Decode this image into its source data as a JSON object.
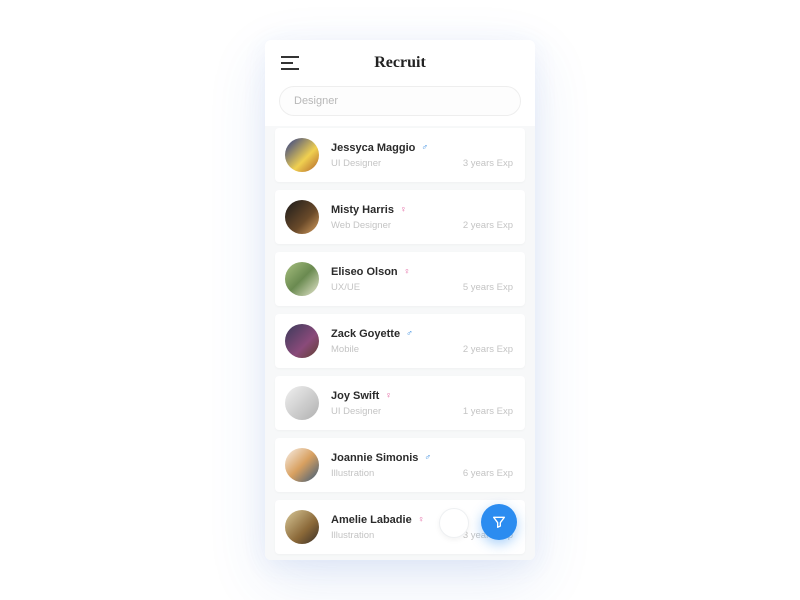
{
  "header": {
    "title": "Recruit"
  },
  "search": {
    "value": "Designer"
  },
  "candidates": [
    {
      "name": "Jessyca Maggio",
      "gender": "m",
      "role": "UI Designer",
      "exp": "3 years Exp"
    },
    {
      "name": "Misty Harris",
      "gender": "f",
      "role": "Web Designer",
      "exp": "2 years Exp"
    },
    {
      "name": "Eliseo Olson",
      "gender": "f",
      "role": "UX/UE",
      "exp": "5 years Exp"
    },
    {
      "name": "Zack Goyette",
      "gender": "m",
      "role": "Mobile",
      "exp": "2 years Exp"
    },
    {
      "name": "Joy Swift",
      "gender": "f",
      "role": "UI Designer",
      "exp": "1 years Exp"
    },
    {
      "name": "Joannie Simonis",
      "gender": "m",
      "role": "Illustration",
      "exp": "6 years Exp"
    },
    {
      "name": "Amelie Labadie",
      "gender": "f",
      "role": "Illustration",
      "exp": "3 years Exp"
    }
  ],
  "gender_symbols": {
    "m": "♂",
    "f": "♀"
  }
}
